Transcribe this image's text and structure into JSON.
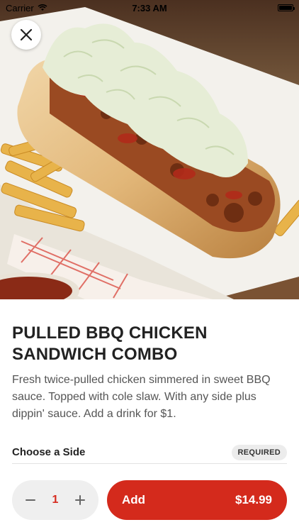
{
  "status_bar": {
    "carrier": "Carrier",
    "time": "7:33 AM",
    "battery_level": 1.0
  },
  "hero": {
    "image": "pulled-bbq-chicken-sandwich-photo"
  },
  "close_button": {
    "icon": "close-icon"
  },
  "item": {
    "title": "PULLED BBQ CHICKEN SANDWICH COMBO",
    "description": "Fresh twice-pulled chicken simmered in sweet BBQ sauce. Topped with cole slaw. With any side plus dippin' sauce. Add a drink for $1."
  },
  "side_section": {
    "title": "Choose a Side",
    "badge": "REQUIRED"
  },
  "bottom_bar": {
    "quantity": "1",
    "decrement_icon": "minus-icon",
    "increment_icon": "plus-icon",
    "add_label": "Add",
    "price": "$14.99"
  },
  "colors": {
    "accent": "#d42a1c",
    "quantity_text": "#d62a1e",
    "badge_bg": "#ececec"
  }
}
